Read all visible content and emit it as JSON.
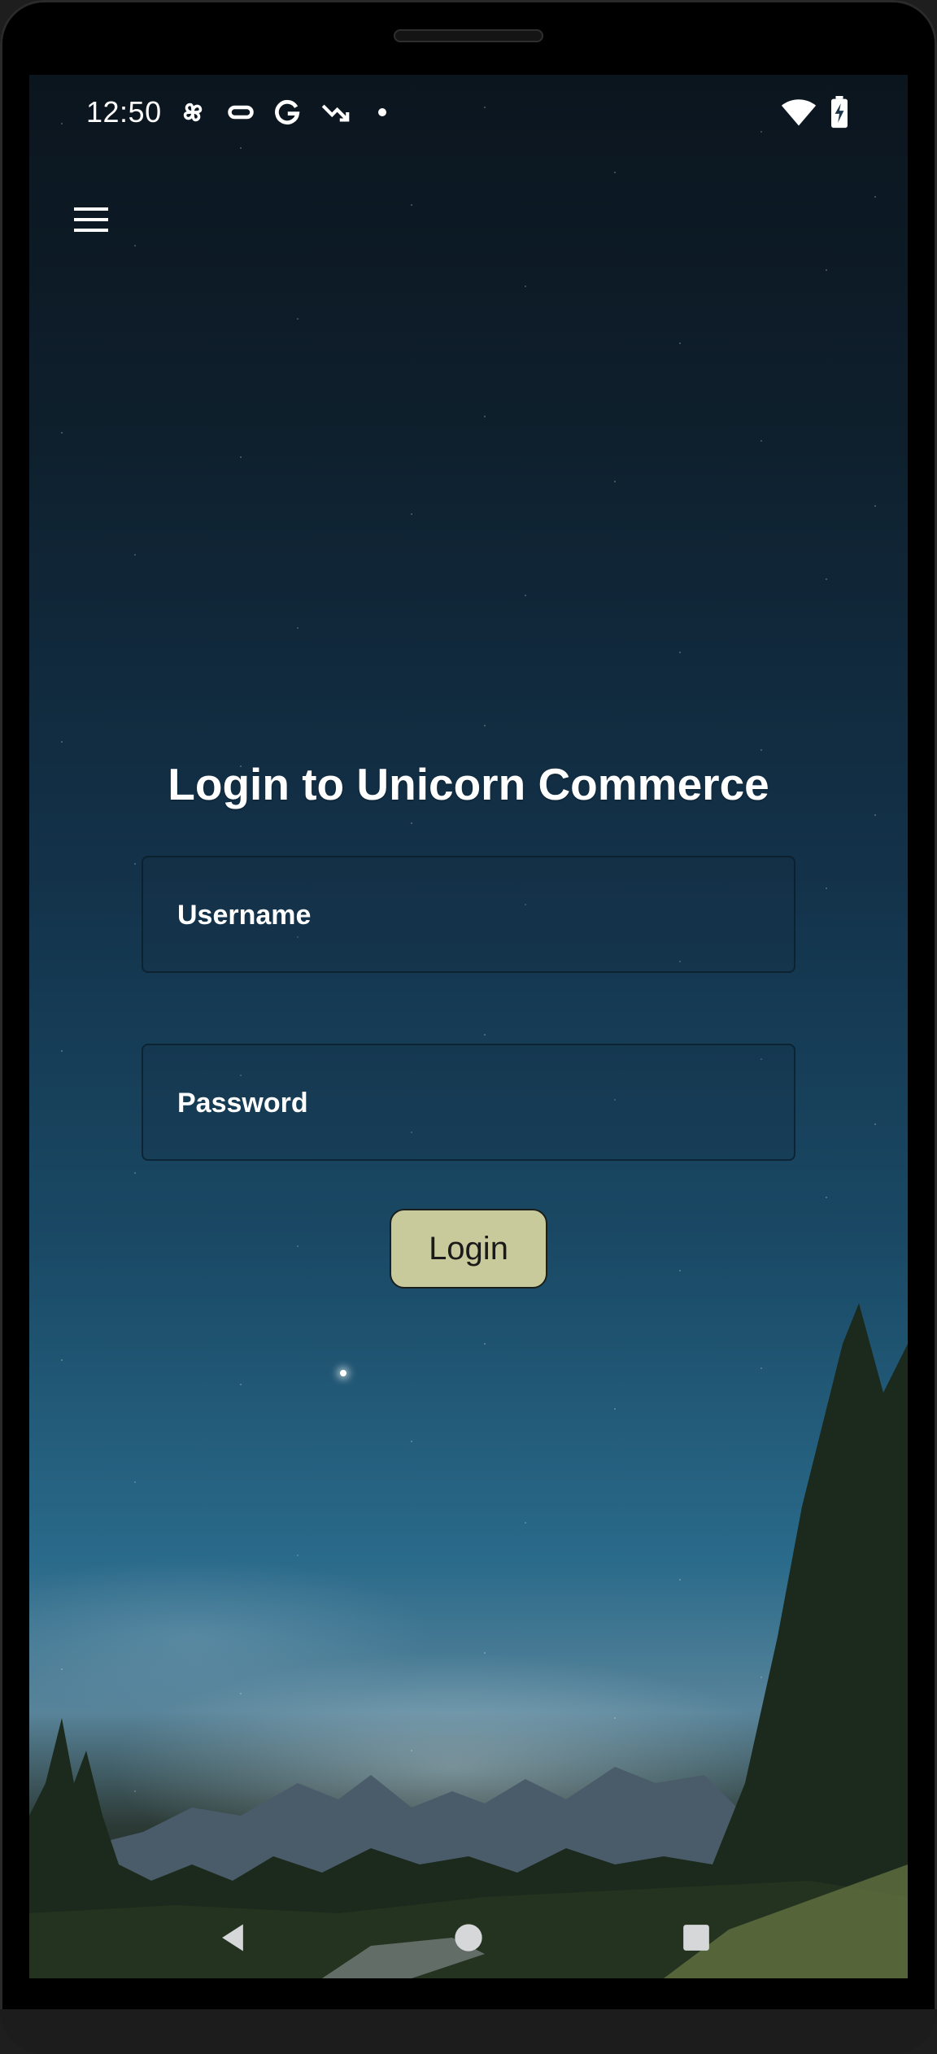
{
  "status_bar": {
    "time": "12:50",
    "left_icons": [
      "pinwheel-icon",
      "pill-icon",
      "google-icon",
      "trending-down-icon",
      "dot-icon"
    ],
    "right_icons": [
      "wifi-icon",
      "battery-charging-icon"
    ]
  },
  "app_bar": {
    "menu_icon": "hamburger-menu-icon"
  },
  "login": {
    "title": "Login to Unicorn Commerce",
    "username_placeholder": "Username",
    "password_placeholder": "Password",
    "button_label": "Login"
  },
  "nav_bar": {
    "icons": [
      "back-icon",
      "home-icon",
      "recents-icon"
    ]
  },
  "colors": {
    "button_bg": "#c9ca9c",
    "text": "#ffffff",
    "sky_dark": "#0b151e",
    "sky_mid": "#1a4a66"
  }
}
